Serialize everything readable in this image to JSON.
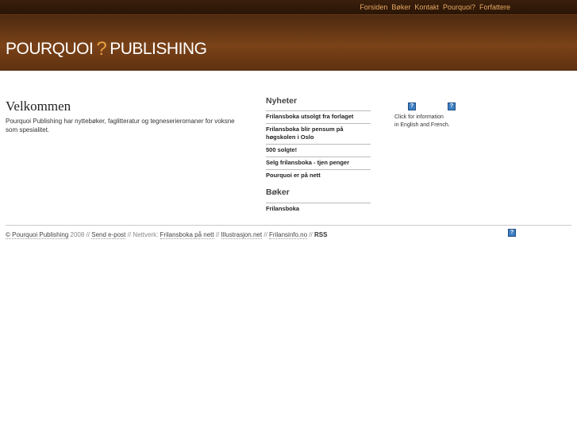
{
  "nav": {
    "items": [
      "Forsiden",
      "Bøker",
      "Kontakt",
      "Pourquoi?",
      "Forfattere"
    ]
  },
  "logo": {
    "left": "POURQUOI",
    "mark": "?",
    "right": "PUBLISHING"
  },
  "welcome": {
    "title": "Velkommen",
    "text": "Pourquoi Publishing har nyttebøker, faglitteratur og tegneserieromaner for voksne som spesialitet."
  },
  "news": {
    "title": "Nyheter",
    "items": [
      "Frilansboka utsolgt fra forlaget",
      "Frilansboka blir pensum på høgskolen i Oslo",
      "500 solgte!",
      "Selg frilansboka - tjen penger",
      "Pourquoi er på nett"
    ]
  },
  "books": {
    "title": "Bøker",
    "items": [
      "Frilansboka"
    ]
  },
  "language": {
    "caption_line1": "Click for information",
    "caption_line2": "in English and French.",
    "flag_glyph": "?"
  },
  "footer": {
    "copyright": "© Pourquoi Publishing",
    "year": "2008",
    "sep": "//",
    "email": "Send e-post",
    "network_label": "Nettverk:",
    "links": [
      "Frilansboka på nett",
      "Illustrasjon.net",
      "Frilansinfo.no"
    ],
    "rss": "RSS"
  },
  "colors": {
    "topbar": "#2a1505",
    "banner": "#7a4218",
    "nav_link": "#e8a860",
    "logo_mark": "#e8a040",
    "flag": "#3e7fc2"
  }
}
